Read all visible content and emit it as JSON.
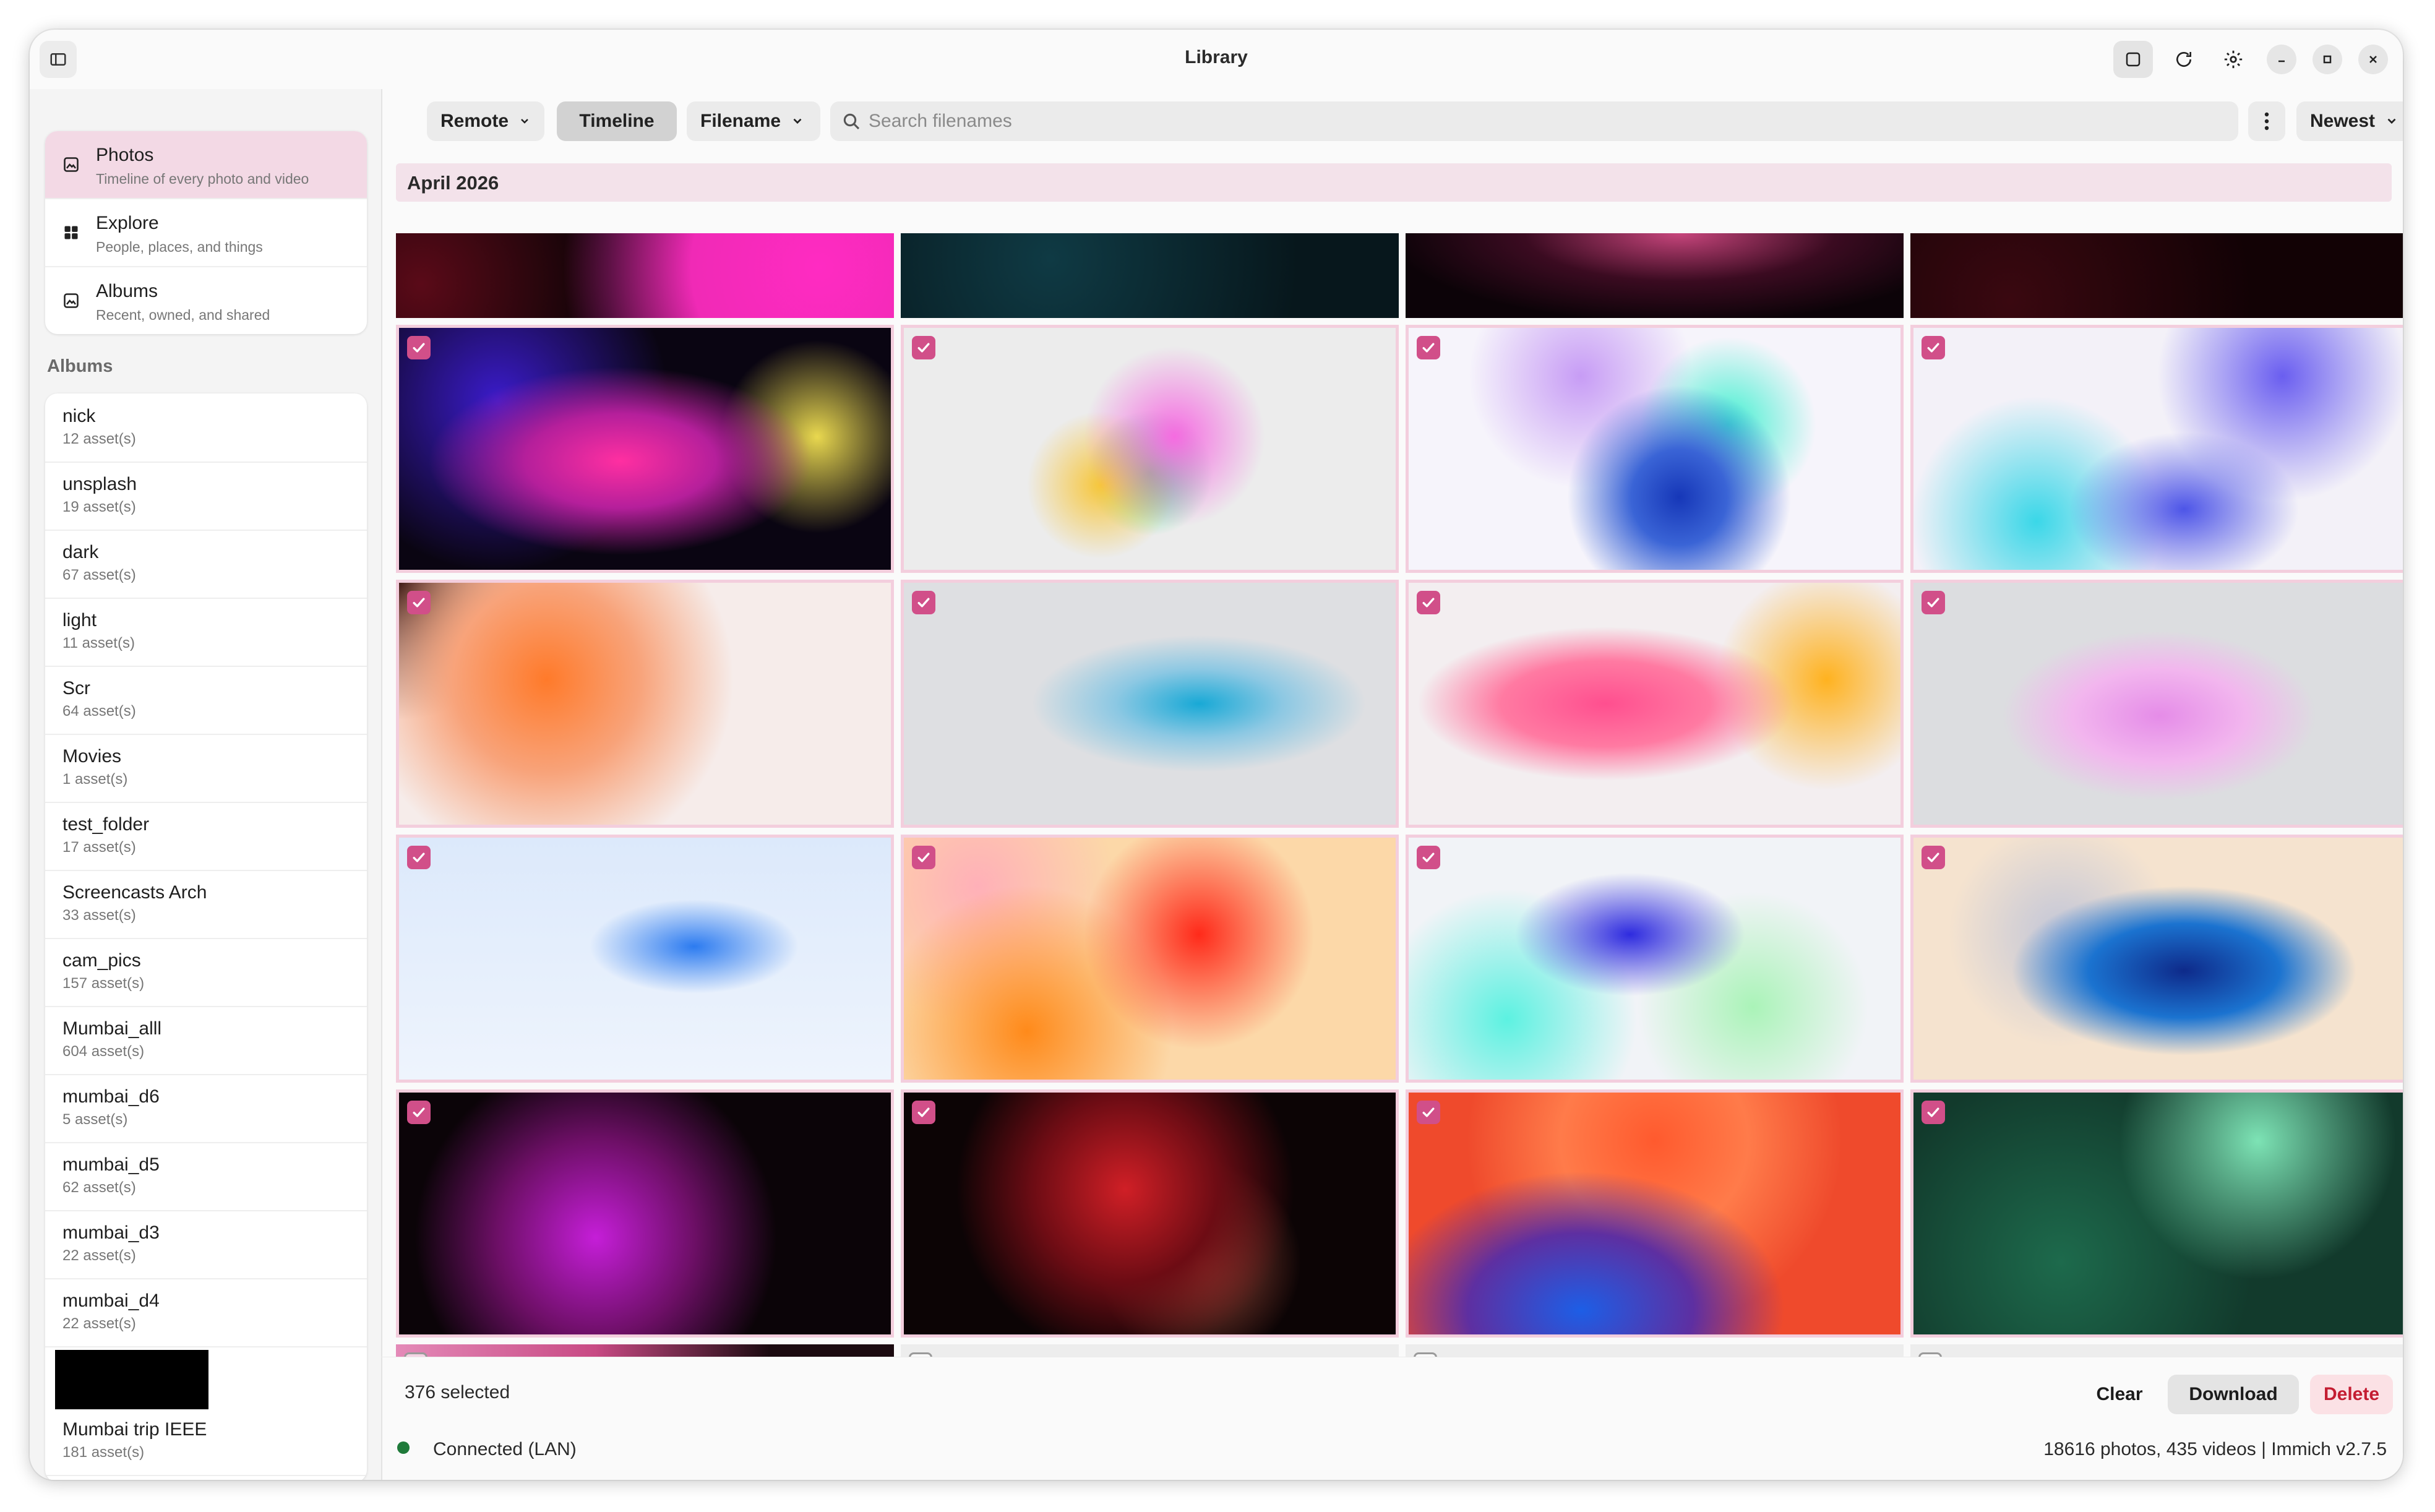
{
  "window": {
    "title": "Library"
  },
  "toolbar": {
    "source_label": "Remote",
    "timeline_label": "Timeline",
    "sort_field_label": "Filename",
    "search_placeholder": "Search filenames",
    "sort_order_label": "Newest"
  },
  "sidebar": {
    "nav": [
      {
        "label": "Photos",
        "sub": "Timeline of every photo and video",
        "icon": "image-icon",
        "active": true
      },
      {
        "label": "Explore",
        "sub": "People, places, and things",
        "icon": "grid-icon",
        "active": false
      },
      {
        "label": "Albums",
        "sub": "Recent, owned, and shared",
        "icon": "image-icon",
        "active": false
      }
    ],
    "albums_heading": "Albums",
    "albums": [
      {
        "name": "nick",
        "count": "12 asset(s)"
      },
      {
        "name": "unsplash",
        "count": "19 asset(s)"
      },
      {
        "name": "dark",
        "count": "67 asset(s)"
      },
      {
        "name": "light",
        "count": "11 asset(s)"
      },
      {
        "name": "Scr",
        "count": "64 asset(s)"
      },
      {
        "name": "Movies",
        "count": "1 asset(s)"
      },
      {
        "name": "test_folder",
        "count": "17 asset(s)"
      },
      {
        "name": "Screencasts Arch",
        "count": "33 asset(s)"
      },
      {
        "name": "cam_pics",
        "count": "157 asset(s)"
      },
      {
        "name": "Mumbai_alll",
        "count": "604 asset(s)"
      },
      {
        "name": "mumbai_d6",
        "count": "5 asset(s)"
      },
      {
        "name": "mumbai_d5",
        "count": "62 asset(s)"
      },
      {
        "name": "mumbai_d3",
        "count": "22 asset(s)"
      },
      {
        "name": "mumbai_d4",
        "count": "22 asset(s)"
      },
      {
        "name": "Mumbai trip IEEE",
        "count": "181 asset(s)"
      }
    ]
  },
  "timeline": {
    "section_label": "April 2026",
    "top_row_bg": [
      "radial-gradient(circle at 85% 40%, #ff2bc2 0%, #f02ab6 30%, transparent 60%), radial-gradient(circle at 5% 60%, #5a0a18 0%, transparent 40%), #0b0306",
      "radial-gradient(circle at 30% 30%, #0f3a44 0%, transparent 70%), #07171c",
      "radial-gradient(ellipse at 55% 0%, #c7457c 0%, #3b0b21 40%, transparent 75%), #0c0308",
      "radial-gradient(circle at 20% 80%, #3a0810 0%, transparent 60%), #120205"
    ],
    "rows": [
      [
        {
          "selected": true,
          "bg": "radial-gradient(ellipse at 45% 55%, #ff2fa1 0%, #b51f9b 25%, transparent 50%), radial-gradient(circle at 85% 45%, #e9d84f 0%, transparent 22%), radial-gradient(circle at 20% 30%, #3a1bc9 0%, transparent 40%), #0a0512"
        },
        {
          "selected": true,
          "bg": "radial-gradient(circle at 55% 45%, #f56be1 0%, transparent 30%), radial-gradient(circle at 40% 65%, #f7c63b 0%, transparent 22%), radial-gradient(circle at 50% 60%, #37d885 0%, transparent 22%), #ececec"
        },
        {
          "selected": true,
          "bg": "radial-gradient(circle at 55% 70%, #1637b8 0%, #3a64d6 15%, transparent 35%), radial-gradient(circle at 65% 40%, #40f0d0 0%, transparent 25%), radial-gradient(circle at 35% 20%, #c79cf5 0%, transparent 30%), #f6f4fb"
        },
        {
          "selected": true,
          "bg": "radial-gradient(ellipse at 55% 75%, #4d55e8 0%, transparent 30%), radial-gradient(circle at 25% 80%, #3ad7e8 0%, transparent 30%), radial-gradient(circle at 75% 20%, #6a5ef0 0%, transparent 30%), #f3f1f8"
        }
      ],
      [
        {
          "selected": true,
          "bg": "radial-gradient(circle at 30% 40%, #ff7a2a 0%, #f8a37a 25%, transparent 50%), radial-gradient(circle at 0% 0%, #2a0a0a 0%, transparent 25%), #f6ecea"
        },
        {
          "selected": true,
          "bg": "radial-gradient(ellipse at 60% 50%, #18a9d6 0%, #8cc8e3 20%, transparent 40%), #dedfe2"
        },
        {
          "selected": true,
          "bg": "radial-gradient(ellipse at 40% 50%, #ff4f8f 0%, #ff7aa2 25%, transparent 45%), radial-gradient(circle at 85% 40%, #ffb21f 0%, transparent 25%), #f3eef0"
        },
        {
          "selected": true,
          "bg": "radial-gradient(ellipse at 50% 55%, #e58ce8 0%, #f2b6ee 25%, transparent 45%), #dcdde0"
        }
      ],
      [
        {
          "selected": true,
          "bg": "radial-gradient(ellipse at 60% 45%, #2c7bf0 0%, transparent 25%), linear-gradient(180deg, #dce9fb 0%, #eef4fd 100%)"
        },
        {
          "selected": true,
          "bg": "radial-gradient(circle at 60% 40%, #ff2a1a 0%, transparent 35%), radial-gradient(circle at 25% 80%, #ff8a1a 0%, transparent 35%), radial-gradient(circle at 15% 20%, #ffb0b8 0%, transparent 30%), #fcd8a8"
        },
        {
          "selected": true,
          "bg": "radial-gradient(ellipse at 45% 40%, #2e2bdf 0%, transparent 30%), radial-gradient(circle at 20% 75%, #5cf2e1 0%, transparent 30%), radial-gradient(circle at 70% 70%, #aaf3b8 0%, transparent 30%), #f1f3f7"
        },
        {
          "selected": true,
          "bg": "radial-gradient(ellipse at 55% 55%, #0e2a8a 0%, #1b73d0 25%, transparent 45%), radial-gradient(circle at 30% 40%, #c2c6d8 0%, transparent 30%), #f5e3cf"
        }
      ],
      [
        {
          "selected": true,
          "bg": "radial-gradient(circle at 40% 60%, #c51ed8 0%, #6d0f66 30%, transparent 55%), #0b0408"
        },
        {
          "selected": true,
          "bg": "radial-gradient(circle at 45% 40%, #d01f26 0%, #6d0c14 30%, transparent 55%), radial-gradient(circle at 60% 70%, #a04a3a 0%, transparent 30%), #0c0405"
        },
        {
          "selected": true,
          "bg": "radial-gradient(ellipse at 35% 90%, #1d5ee6 0%, #5e2fa1 25%, transparent 45%), radial-gradient(circle at 50% 20%, #ff5a2e 0%, #ff7b4a 30%, transparent 60%), #ef4a2c"
        },
        {
          "selected": true,
          "bg": "radial-gradient(circle at 70% 20%, #7de3b5 0%, transparent 35%), radial-gradient(circle at 30% 70%, #1d6a4c 0%, transparent 50%), #123a2c"
        }
      ]
    ],
    "bottom_row_bg": [
      "linear-gradient(90deg, #e48ab8 0%, #c84a84 40%, #1b0a10 75%)",
      "#ededed",
      "#ededed",
      "#ededed"
    ],
    "bottom_row_selected": [
      false,
      false,
      false,
      false
    ]
  },
  "selection": {
    "count_label": "376 selected",
    "clear_label": "Clear",
    "download_label": "Download",
    "delete_label": "Delete"
  },
  "status": {
    "connection": "Connected (LAN)",
    "connection_color": "#1f7a3a",
    "stats": "18616 photos, 435 videos | Immich v2.7.5"
  },
  "colors": {
    "accent": "#d14f89",
    "active_nav": "#f3d9e5",
    "delete_bg": "#fbe1e5",
    "delete_text": "#c41d32"
  }
}
